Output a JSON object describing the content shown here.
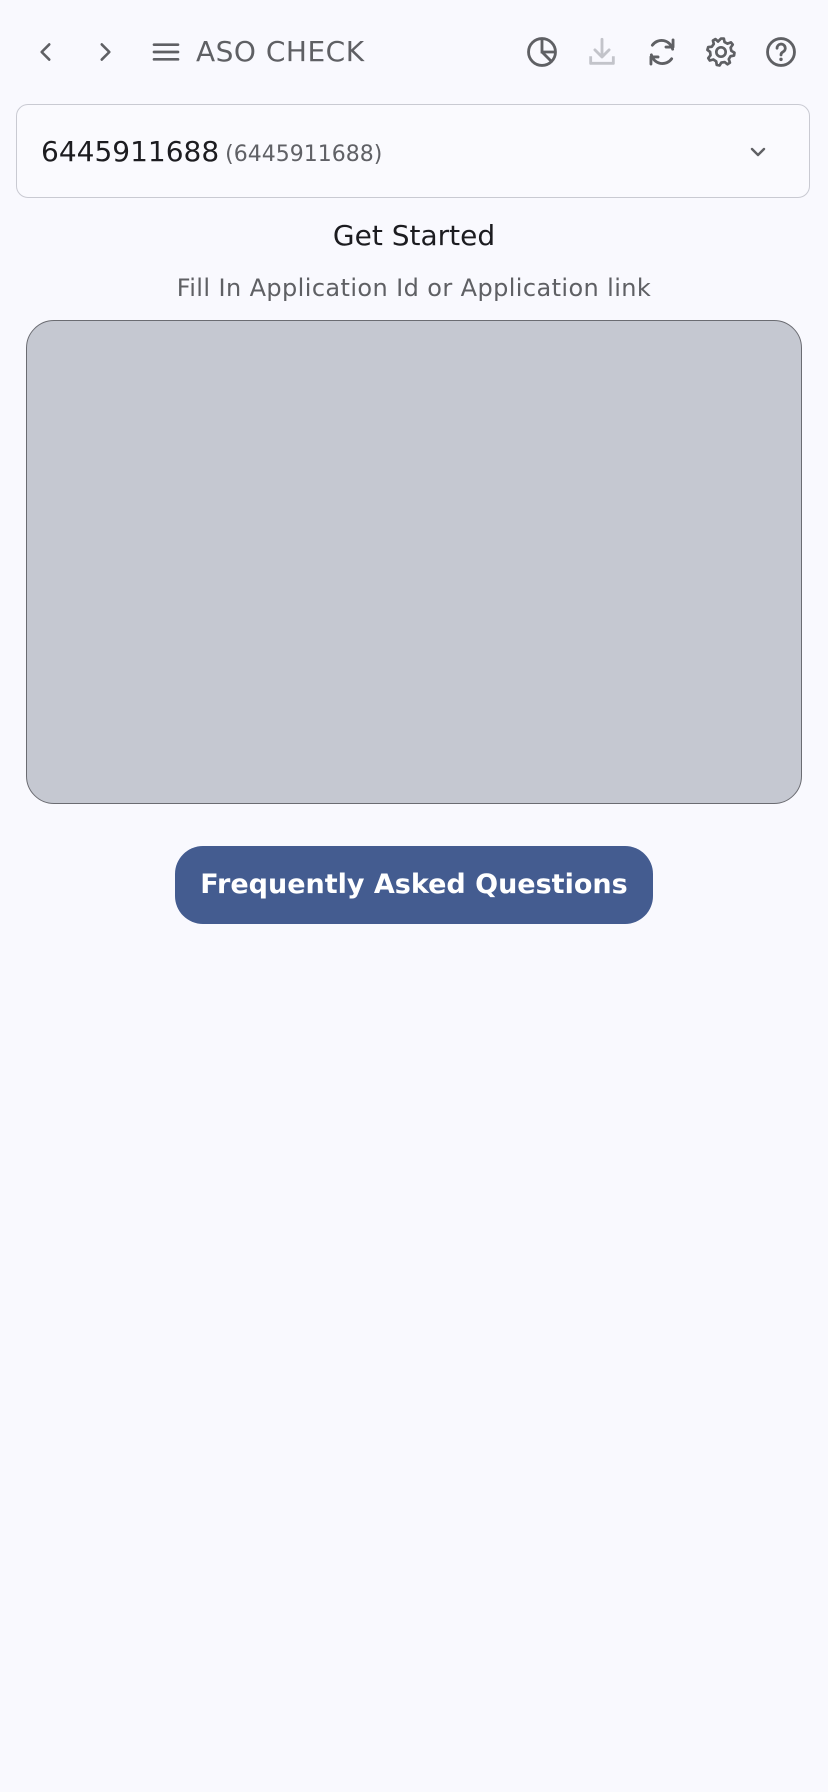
{
  "toolbar": {
    "title": "ASO CHECK",
    "icons": {
      "back": "chevron-left-icon",
      "forward": "chevron-right-icon",
      "menu": "hamburger-menu-icon",
      "stats": "pie-chart-icon",
      "download": "download-icon",
      "refresh": "refresh-icon",
      "settings": "gear-icon",
      "help": "help-icon"
    },
    "download_disabled": true
  },
  "app_selector": {
    "value": "6445911688",
    "detail": "(6445911688)"
  },
  "main": {
    "heading": "Get Started",
    "subheading": "Fill In Application Id or Application link",
    "input_value": ""
  },
  "faq_button": {
    "label": "Frequently Asked Questions"
  },
  "colors": {
    "background": "#f9f9fe",
    "accent": "#445c90",
    "input_fill": "#c5c8d1",
    "icon": "#5f6064",
    "icon_disabled": "#c3c4ca"
  }
}
